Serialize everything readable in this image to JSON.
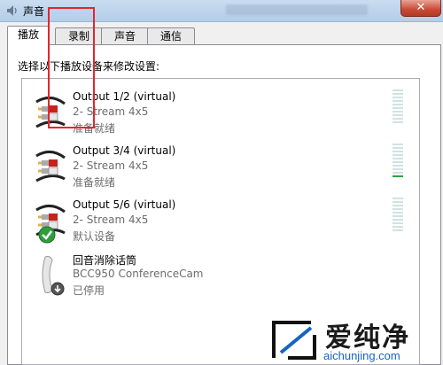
{
  "window": {
    "title": "声音",
    "close_label": "✕"
  },
  "tabs": [
    {
      "label": "播放",
      "active": true
    },
    {
      "label": "录制",
      "active": false
    },
    {
      "label": "声音",
      "active": false
    },
    {
      "label": "通信",
      "active": false
    }
  ],
  "instruction": "选择以下播放设备来修改设置:",
  "devices": [
    {
      "name": "Output 1/2 (virtual)",
      "sub": "2- Stream 4x5",
      "status": "准备就绪",
      "icon": "rca-cable-icon",
      "meter_level": 0
    },
    {
      "name": "Output 3/4 (virtual)",
      "sub": "2- Stream 4x5",
      "status": "准备就绪",
      "icon": "rca-cable-icon",
      "meter_level": 0.1
    },
    {
      "name": "Output 5/6 (virtual)",
      "sub": "2- Stream 4x5",
      "status": "默认设备",
      "icon": "rca-cable-icon",
      "badge": "default-checkmark-icon",
      "meter_level": 0
    },
    {
      "name": "回音消除话筒",
      "sub": "BCC950 ConferenceCam",
      "status": "已停用",
      "icon": "handset-icon",
      "badge": "disabled-arrow-icon"
    }
  ],
  "watermark": {
    "text": "爱纯净",
    "url": "aichunjing.com"
  },
  "colors": {
    "accent_red": "#e3262d",
    "meter_on": "#2aa23c",
    "meter_off": "#cfe3e2"
  }
}
